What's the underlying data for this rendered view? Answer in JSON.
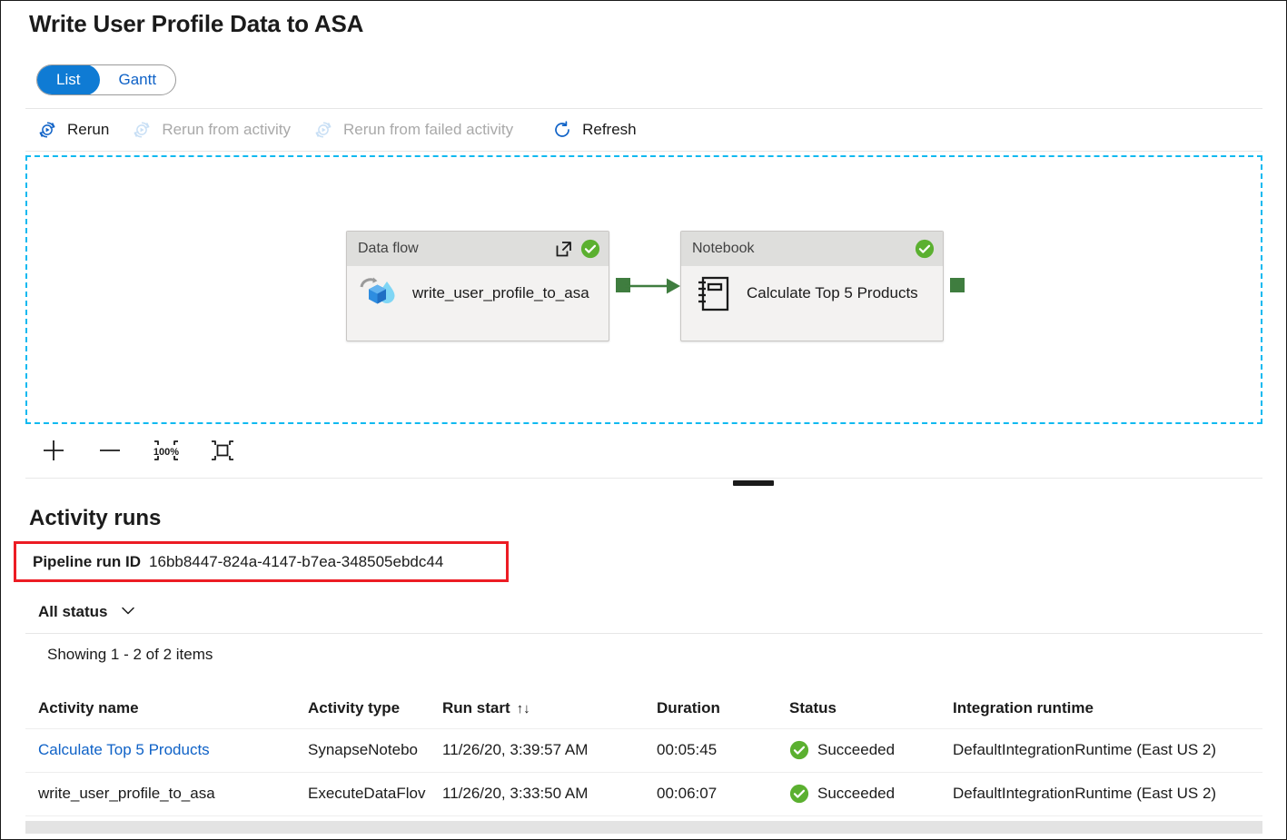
{
  "header": {
    "title": "Write User Profile Data to ASA"
  },
  "view_toggle": {
    "options": [
      {
        "label": "List",
        "active": true
      },
      {
        "label": "Gantt",
        "active": false
      }
    ]
  },
  "toolbar": {
    "rerun_label": "Rerun",
    "rerun_from_activity_label": "Rerun from activity",
    "rerun_from_failed_activity_label": "Rerun from failed activity",
    "refresh_label": "Refresh"
  },
  "canvas": {
    "border_color": "#10b9f0",
    "connector_color": "#3f7d3f",
    "nodes": [
      {
        "type_label": "Data flow",
        "name": "write_user_profile_to_asa",
        "status": "succeeded",
        "status_color": "#5bb030",
        "has_open_link": true
      },
      {
        "type_label": "Notebook",
        "name": "Calculate Top 5 Products",
        "status": "succeeded",
        "status_color": "#5bb030",
        "has_open_link": false
      }
    ]
  },
  "zoom_controls": {
    "zoom_in_label": "Zoom in",
    "zoom_out_label": "Zoom out",
    "zoom_reset_label": "100%",
    "fit_label": "Zoom to fit"
  },
  "activity_runs": {
    "section_title": "Activity runs",
    "pipeline_run_id_label": "Pipeline run ID",
    "pipeline_run_id_value": "16bb8447-824a-4147-b7ea-348505ebdc44",
    "highlight_color": "#ec1c24",
    "status_filter_label": "All status",
    "showing_text": "Showing 1 - 2 of 2 items",
    "columns": [
      "Activity name",
      "Activity type",
      "Run start",
      "Duration",
      "Status",
      "Integration runtime"
    ],
    "sort_column": "Run start",
    "rows": [
      {
        "activity_name": "Calculate Top 5 Products",
        "activity_name_is_link": true,
        "activity_type": "SynapseNotebo",
        "run_start": "11/26/20, 3:39:57 AM",
        "duration": "00:05:45",
        "status": "Succeeded",
        "integration_runtime": "DefaultIntegrationRuntime (East US 2)"
      },
      {
        "activity_name": "write_user_profile_to_asa",
        "activity_name_is_link": false,
        "activity_type": "ExecuteDataFlov",
        "run_start": "11/26/20, 3:33:50 AM",
        "duration": "00:06:07",
        "status": "Succeeded",
        "integration_runtime": "DefaultIntegrationRuntime (East US 2)"
      }
    ]
  }
}
